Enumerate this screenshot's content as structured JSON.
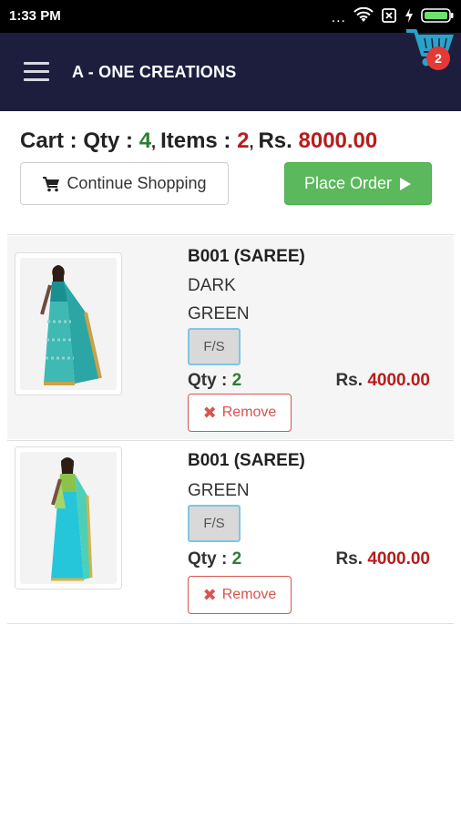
{
  "status_bar": {
    "time": "1:33 PM",
    "dots": "...",
    "icons": [
      "wifi-icon",
      "sim-x-icon",
      "charging-icon",
      "battery-icon"
    ]
  },
  "app_bar": {
    "title": "A - ONE CREATIONS",
    "cart_count": "2"
  },
  "summary": {
    "cart_label": "Cart : Qty :",
    "qty": "4",
    "items_label": "Items :",
    "items": "2",
    "total_label": "Rs.",
    "total": "8000.00"
  },
  "actions": {
    "continue_label": "Continue Shopping",
    "place_order_label": "Place Order"
  },
  "cart_items": [
    {
      "name": "B001 (SAREE)",
      "color_line1": "DARK",
      "color_line2": "GREEN",
      "size": "F/S",
      "qty_label": "Qty :",
      "qty": "2",
      "price_label": "Rs.",
      "price": "4000.00",
      "remove_label": "Remove"
    },
    {
      "name": "B001 (SAREE)",
      "color_line1": "GREEN",
      "size": "F/S",
      "qty_label": "Qty :",
      "qty": "2",
      "price_label": "Rs.",
      "price": "4000.00",
      "remove_label": "Remove"
    }
  ],
  "colors": {
    "app_bar": "#1d1e3d",
    "cart_icon": "#29a3c9",
    "badge": "#e53935",
    "place_order": "#5cb85c",
    "remove": "#d9534f",
    "qty_green": "#2e7d32",
    "price_red": "#b71c1c"
  }
}
